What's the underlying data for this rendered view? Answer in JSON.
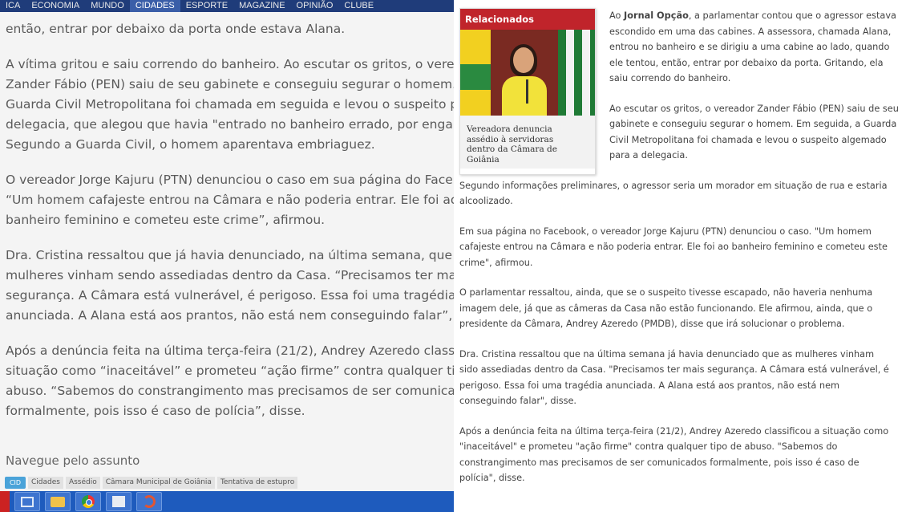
{
  "top_nav": [
    "ICA",
    "ECONOMIA",
    "MUNDO",
    "CIDADES",
    "ESPORTE",
    "MAGAZINE",
    "OPINIÃO",
    "CLUBE"
  ],
  "left_article": {
    "paragraphs": [
      [
        "então, entrar por debaixo da porta onde estava Alana."
      ],
      [
        "A vítima gritou e saiu correndo do banheiro. Ao escutar os gritos, o vereador",
        "Zander Fábio (PEN) saiu de seu gabinete e conseguiu segurar o homem. A",
        "Guarda Civil Metropolitana foi chamada em seguida e levou o suspeito para a",
        "delegacia, que alegou que havia \"entrado no banheiro errado, por engano\".",
        "Segundo a Guarda Civil, o homem aparentava embriaguez."
      ],
      [
        "O vereador Jorge Kajuru (PTN) denunciou o caso em sua página do Facebook:",
        "“Um homem cafajeste entrou na Câmara e não poderia entrar. Ele foi ao",
        "banheiro feminino e cometeu este crime”, afirmou."
      ],
      [
        "Dra. Cristina ressaltou que já havia denunciado, na última semana, que as",
        "mulheres vinham sendo assediadas dentro da Casa. “Precisamos ter mais",
        "segurança. A Câmara está vulnerável, é perigoso. Essa foi uma tragédia",
        "anunciada. A Alana está aos prantos, não está nem conseguindo falar”, disse."
      ],
      [
        "Após a denúncia feita na última terça-feira (21/2), Andrey Azeredo classificou a",
        "situação como “inaceitável” e prometeu “ação firme” contra qualquer tipo de",
        "abuso. “Sabemos do constrangimento mas precisamos de ser comunicados",
        "formalmente, pois isso é caso de polícia”, disse."
      ]
    ],
    "navegue_label": "Navegue pelo assunto",
    "tag_icon_label": "CID",
    "tags": [
      "Cidades",
      "Assédio",
      "Câmara Municipal de Goiânia",
      "Tentativa de estupro"
    ]
  },
  "related_card": {
    "header": "Relacionados",
    "caption": [
      "Vereadora denuncia",
      "assédio à servidoras",
      "dentro da Câmara de",
      "Goiânia"
    ]
  },
  "right_article": {
    "wrapped_paragraphs": [
      [
        "Ao Jornal Opção, a parlamentar contou que o agressor estava",
        "escondido em uma das cabines. A assessora, chamada Alana,",
        "entrou no banheiro e se dirigiu a uma cabine ao lado, quando",
        "ele tentou, então, entrar por debaixo da porta. Gritando, ela",
        "saiu correndo do banheiro."
      ],
      [
        "Ao escutar os gritos, o vereador Zander Fábio (PEN) saiu de seu",
        "gabinete e conseguiu segurar o homem. Em seguida, a Guarda",
        "Civil Metropolitana foi chamada e levou o suspeito algemado",
        "para a delegacia."
      ]
    ],
    "paragraphs": [
      [
        "Segundo informações preliminares, o agressor seria um morador em situação de rua e estaria",
        "alcoolizado."
      ],
      [
        "Em sua página no Facebook, o vereador Jorge Kajuru (PTN) denunciou o caso. \"Um homem",
        "cafajeste entrou na Câmara e não poderia entrar. Ele foi ao banheiro feminino e cometeu este",
        "crime\", afirmou."
      ],
      [
        "O parlamentar ressaltou, ainda, que se o suspeito tivesse escapado, não haveria nenhuma",
        "imagem dele, já que as câmeras da Casa não estão funcionando. Ele afirmou, ainda, que o",
        "presidente da Câmara, Andrey Azeredo (PMDB), disse que irá solucionar o problema."
      ],
      [
        "Dra. Cristina ressaltou que na última semana já havia denunciado que as mulheres vinham",
        "sido assediadas dentro da Casa. \"Precisamos ter mais segurança. A Câmara está vulnerável, é",
        "perigoso. Essa foi uma tragédia anunciada. A Alana está aos prantos, não está nem",
        "conseguindo falar\", disse."
      ],
      [
        "Após a denúncia feita na última terça-feira (21/2), Andrey Azeredo classificou a situação como",
        "\"inaceitável\" e prometeu \"ação firme\" contra qualquer tipo de abuso. \"Sabemos do",
        "constrangimento mas precisamos de ser comunicados formalmente, pois isso é caso de",
        "polícia\", disse."
      ]
    ]
  },
  "taskbar": {
    "icons": [
      "windows-explorer-icon",
      "folder-icon",
      "chrome-icon",
      "app-window-icon",
      "red-swirl-app-icon"
    ]
  },
  "colors": {
    "nav_bg": "#1f3c7a",
    "card_header": "#c0242b",
    "taskbar": "#1e5bbd"
  }
}
